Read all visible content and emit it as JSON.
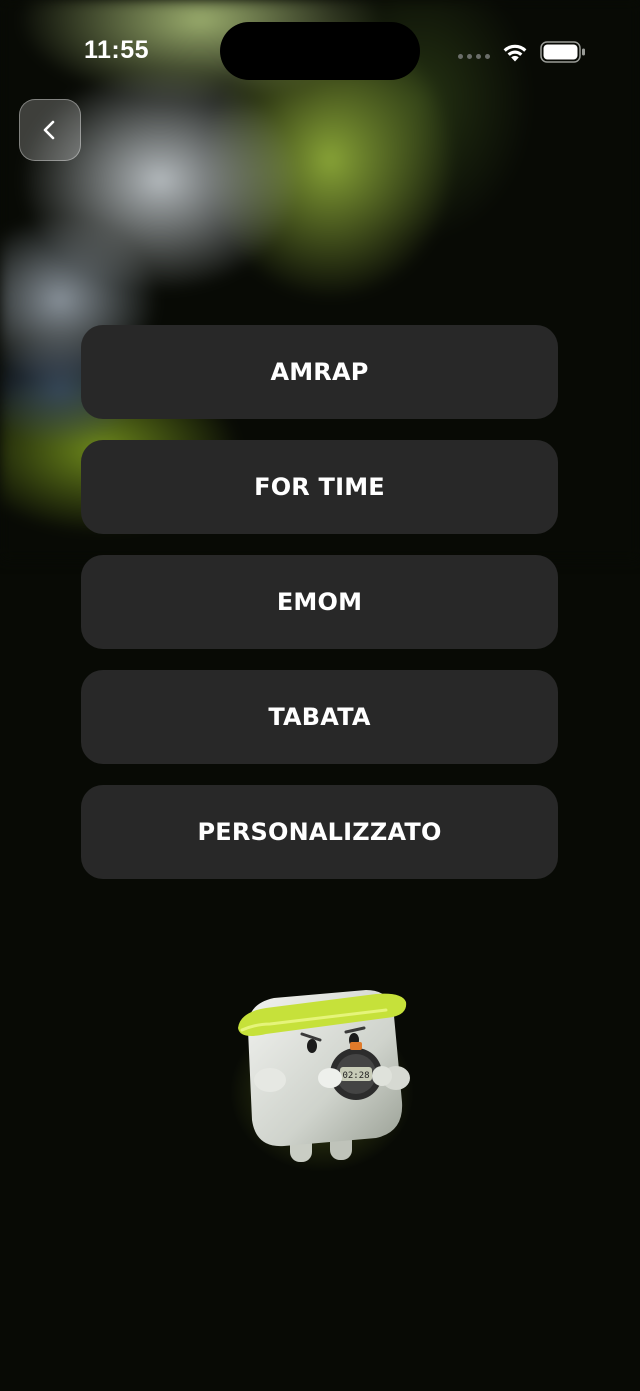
{
  "status_bar": {
    "time": "11:55"
  },
  "nav": {
    "back_icon": "chevron-left-icon"
  },
  "menu": {
    "items": [
      {
        "label": "AMRAP"
      },
      {
        "label": "FOR TIME"
      },
      {
        "label": "EMOM"
      },
      {
        "label": "TABATA"
      },
      {
        "label": "PERSONALIZZATO"
      }
    ]
  },
  "mascot": {
    "stopwatch_display": "02:28"
  },
  "colors": {
    "background": "#080a05",
    "button": "#282828",
    "button_text": "#ffffff",
    "accent": "#c8e63c"
  }
}
